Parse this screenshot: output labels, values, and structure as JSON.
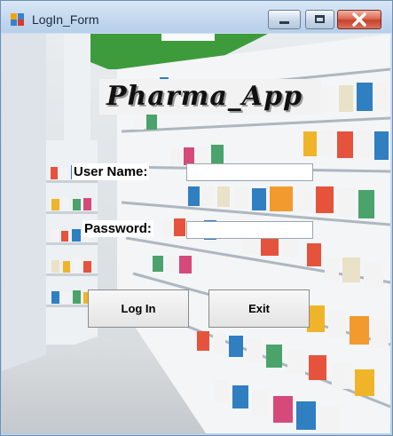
{
  "window": {
    "title": "LogIn_Form",
    "controls": [
      "minimize",
      "maximize",
      "close"
    ]
  },
  "form": {
    "brand_title": "Pharma_App",
    "username_label": "User Name:",
    "username_value": "",
    "password_label": "Password:",
    "password_value": "",
    "login_button": "Log In",
    "exit_button": "Exit"
  },
  "icons": {
    "app": "app-icon",
    "minimize": "minimize-icon",
    "maximize": "maximize-icon",
    "close": "close-icon"
  },
  "colors": {
    "close_button": "#c7412a",
    "title_bar": "#c3d7ee",
    "accent_wall": "#3e9b3c"
  }
}
